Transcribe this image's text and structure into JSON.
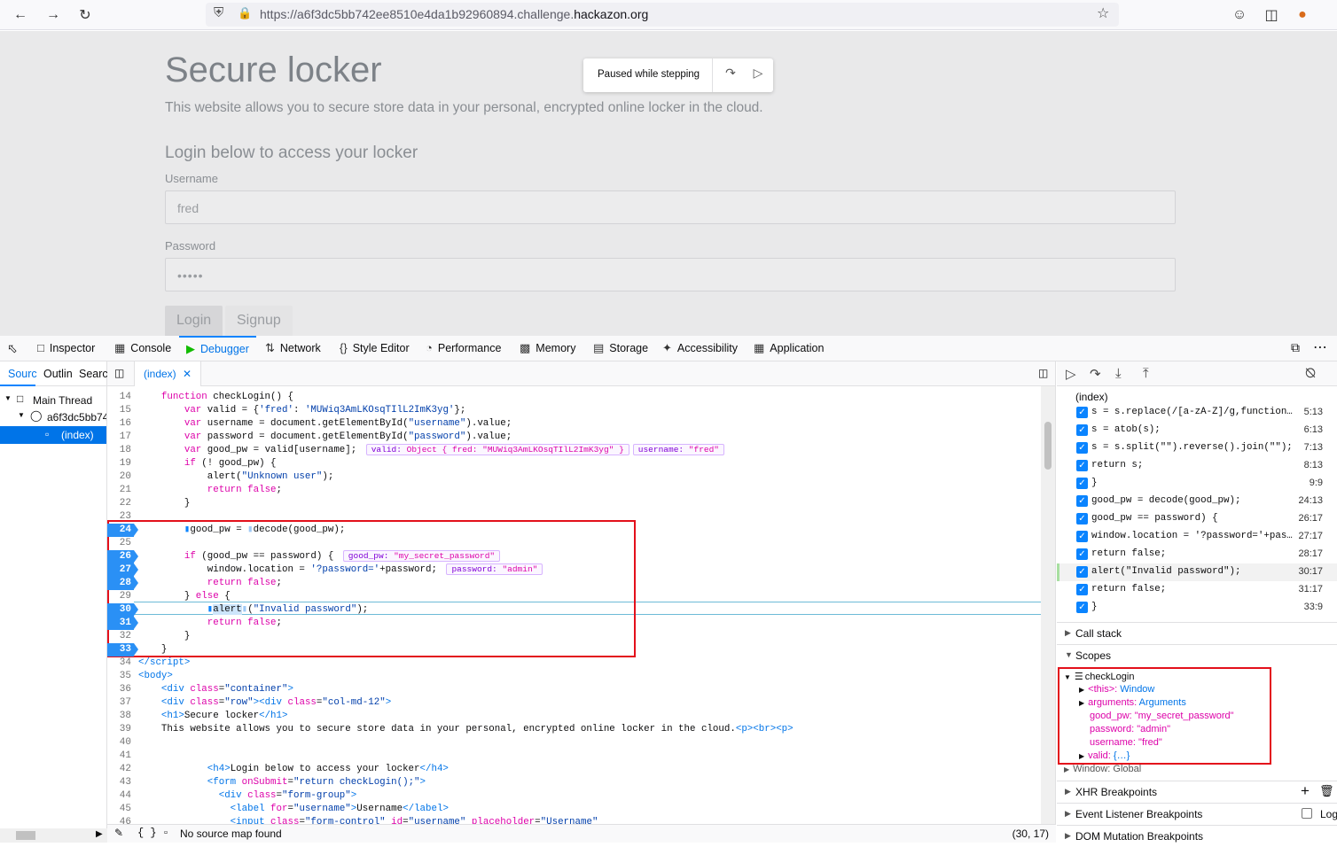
{
  "browser": {
    "url_prefix": "https://a6f3dc5bb742ee8510e4da1b92960894.challenge.",
    "url_domain": "hackazon.org"
  },
  "page": {
    "title": "Secure locker",
    "intro": "This website allows you to secure store data in your personal, encrypted online locker in the cloud.",
    "login_heading": "Login below to access your locker",
    "username_label": "Username",
    "username_value": "fred",
    "password_label": "Password",
    "password_value": "•••••",
    "login_button": "Login",
    "signup_button": "Signup",
    "paused_text": "Paused while stepping"
  },
  "devtools": {
    "tabs": [
      {
        "label": "Inspector",
        "icon": "inspector-icon"
      },
      {
        "label": "Console",
        "icon": "console-icon"
      },
      {
        "label": "Debugger",
        "icon": "debugger-icon"
      },
      {
        "label": "Network",
        "icon": "network-icon"
      },
      {
        "label": "Style Editor",
        "icon": "style-editor-icon"
      },
      {
        "label": "Performance",
        "icon": "performance-icon"
      },
      {
        "label": "Memory",
        "icon": "memory-icon"
      },
      {
        "label": "Storage",
        "icon": "storage-icon"
      },
      {
        "label": "Accessibility",
        "icon": "accessibility-icon"
      },
      {
        "label": "Application",
        "icon": "application-icon"
      }
    ],
    "source_tabs": [
      "Sourc",
      "Outlin",
      "Searcl"
    ],
    "tree": {
      "thread": "Main Thread",
      "host": "a6f3dc5bb74",
      "file": "(index)"
    },
    "editor_tab": "(index)",
    "footer_status": "No source map found",
    "cursor_pos": "(30, 17)",
    "preview": {
      "valid_label": "valid:",
      "valid_value": "Object { fred: \"MUWiq3AmLKOsqTIlL2ImK3yg\" }",
      "username_label": "username:",
      "username_value": "\"fred\"",
      "goodpw_label": "good_pw:",
      "goodpw_value": "\"my_secret_password\"",
      "password_label": "password:",
      "password_value": "\"admin\""
    },
    "breakpoints_file": "(index)",
    "breakpoints": [
      {
        "code": "s = s.replace(/[a-zA-Z]/g,function(c){r…",
        "loc": "5:13"
      },
      {
        "code": "s = atob(s);",
        "loc": "6:13"
      },
      {
        "code": "s = s.split(\"\").reverse().join(\"\");",
        "loc": "7:13"
      },
      {
        "code": "return s;",
        "loc": "8:13"
      },
      {
        "code": "}",
        "loc": "9:9"
      },
      {
        "code": "good_pw = decode(good_pw);",
        "loc": "24:13"
      },
      {
        "code": "good_pw == password) {",
        "loc": "26:17"
      },
      {
        "code": "window.location = '?password='+passwor…",
        "loc": "27:17"
      },
      {
        "code": "return false;",
        "loc": "28:17"
      },
      {
        "code": "alert(\"Invalid password\");",
        "loc": "30:17"
      },
      {
        "code": "return false;",
        "loc": "31:17"
      },
      {
        "code": "}",
        "loc": "33:9"
      }
    ],
    "sections": {
      "call_stack": "Call stack",
      "scopes": "Scopes",
      "xhr": "XHR Breakpoints",
      "event": "Event Listener Breakpoints",
      "dom": "DOM Mutation Breakpoints",
      "log": "Log"
    },
    "scopes": {
      "name": "checkLogin",
      "this_key": "<this>:",
      "this_val": "Window",
      "args_key": "arguments:",
      "args_val": "Arguments",
      "goodpw_key": "good_pw:",
      "goodpw_val": "\"my_secret_password\"",
      "password_key": "password:",
      "password_val": "\"admin\"",
      "username_key": "username:",
      "username_val": "\"fred\"",
      "valid_key": "valid:",
      "valid_val": "{…}",
      "window": "Window: Global"
    }
  }
}
